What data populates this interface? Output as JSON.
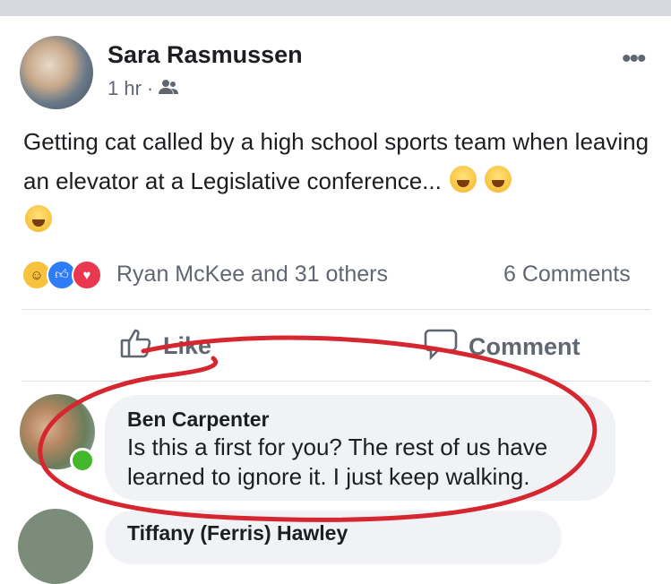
{
  "post": {
    "author": "Sara Rasmussen",
    "time": "1 hr",
    "separator": "·",
    "audience_icon": "friends-icon",
    "more_icon": "more-horizontal-icon",
    "text": "Getting cat called by a high school sports team when leaving an elevator at a Legislative conference...",
    "emoji_icon": "laughing-emoji-icon"
  },
  "reactions": {
    "icons": [
      "haha-reaction-icon",
      "like-reaction-icon",
      "love-reaction-icon"
    ],
    "summary": "Ryan McKee and 31 others",
    "comments_count": "6 Comments"
  },
  "actions": {
    "like_label": "Like",
    "comment_label": "Comment"
  },
  "comment": {
    "author": "Ben Carpenter",
    "text": "Is this a first for you? The rest of us have learned to ignore it. I just keep walking."
  },
  "next_comment": {
    "author": "Tiffany (Ferris) Hawley"
  },
  "colors": {
    "annotation_stroke": "#d6262f",
    "link_blue": "#2e7cf6",
    "online_green": "#42b72a"
  }
}
